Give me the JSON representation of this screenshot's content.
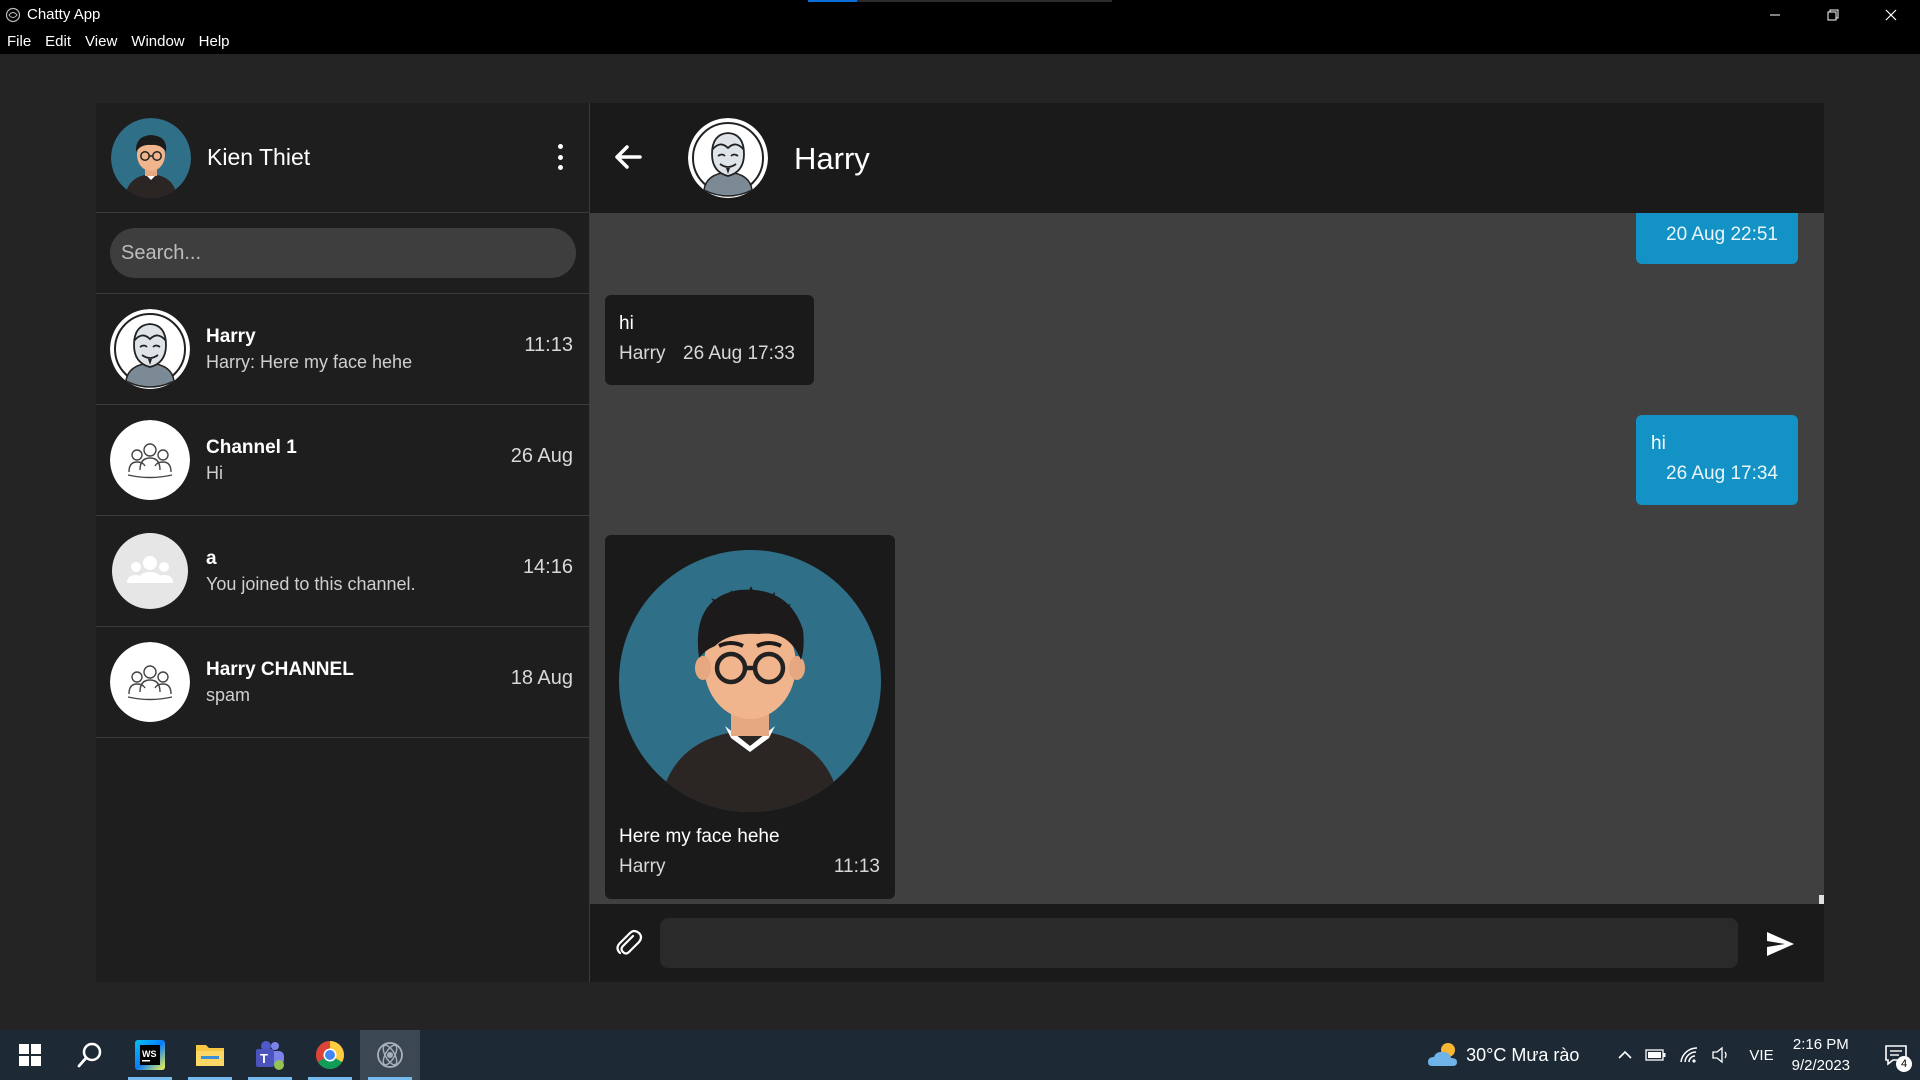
{
  "window": {
    "title": "Chatty App",
    "menu": [
      "File",
      "Edit",
      "View",
      "Window",
      "Help"
    ]
  },
  "profile": {
    "name": "Kien Thiet"
  },
  "search": {
    "placeholder": "Search..."
  },
  "conversations": [
    {
      "name": "Harry",
      "preview": "Harry: Here my face hehe",
      "time": "11:13",
      "avatar": "masked-face-avatar"
    },
    {
      "name": "Channel 1",
      "preview": "Hi",
      "time": "26 Aug",
      "avatar": "group-sketch-avatar"
    },
    {
      "name": "a",
      "preview": "You joined to this channel.",
      "time": "14:16",
      "avatar": "group-default-avatar"
    },
    {
      "name": "Harry CHANNEL",
      "preview": "spam",
      "time": "18 Aug",
      "avatar": "group-sketch-avatar"
    }
  ],
  "chat": {
    "title": "Harry",
    "messages": [
      {
        "direction": "out",
        "text": "",
        "sender": "",
        "time": "20 Aug 22:51"
      },
      {
        "direction": "in",
        "text": "hi",
        "sender": "Harry",
        "time": "26 Aug 17:33"
      },
      {
        "direction": "out",
        "text": "hi",
        "sender": "",
        "time": "26 Aug 17:34"
      },
      {
        "direction": "in",
        "text": "Here my face hehe",
        "sender": "Harry",
        "time": "11:13",
        "attachment": "image"
      }
    ],
    "composer_placeholder": ""
  },
  "taskbar": {
    "apps": [
      "start-icon",
      "search-icon",
      "webstorm-icon",
      "file-explorer-icon",
      "teams-icon",
      "chrome-icon",
      "chatty-app-icon"
    ],
    "weather": "30°C  Mưa rào",
    "language": "VIE",
    "time": "2:16 PM",
    "date": "9/2/2023",
    "notifications": "4"
  },
  "colors": {
    "outgoing_bubble": "#1392c5",
    "incoming_bubble": "#1a1a1a",
    "chat_background": "#404040",
    "sidebar_background": "#1e1e1e"
  }
}
